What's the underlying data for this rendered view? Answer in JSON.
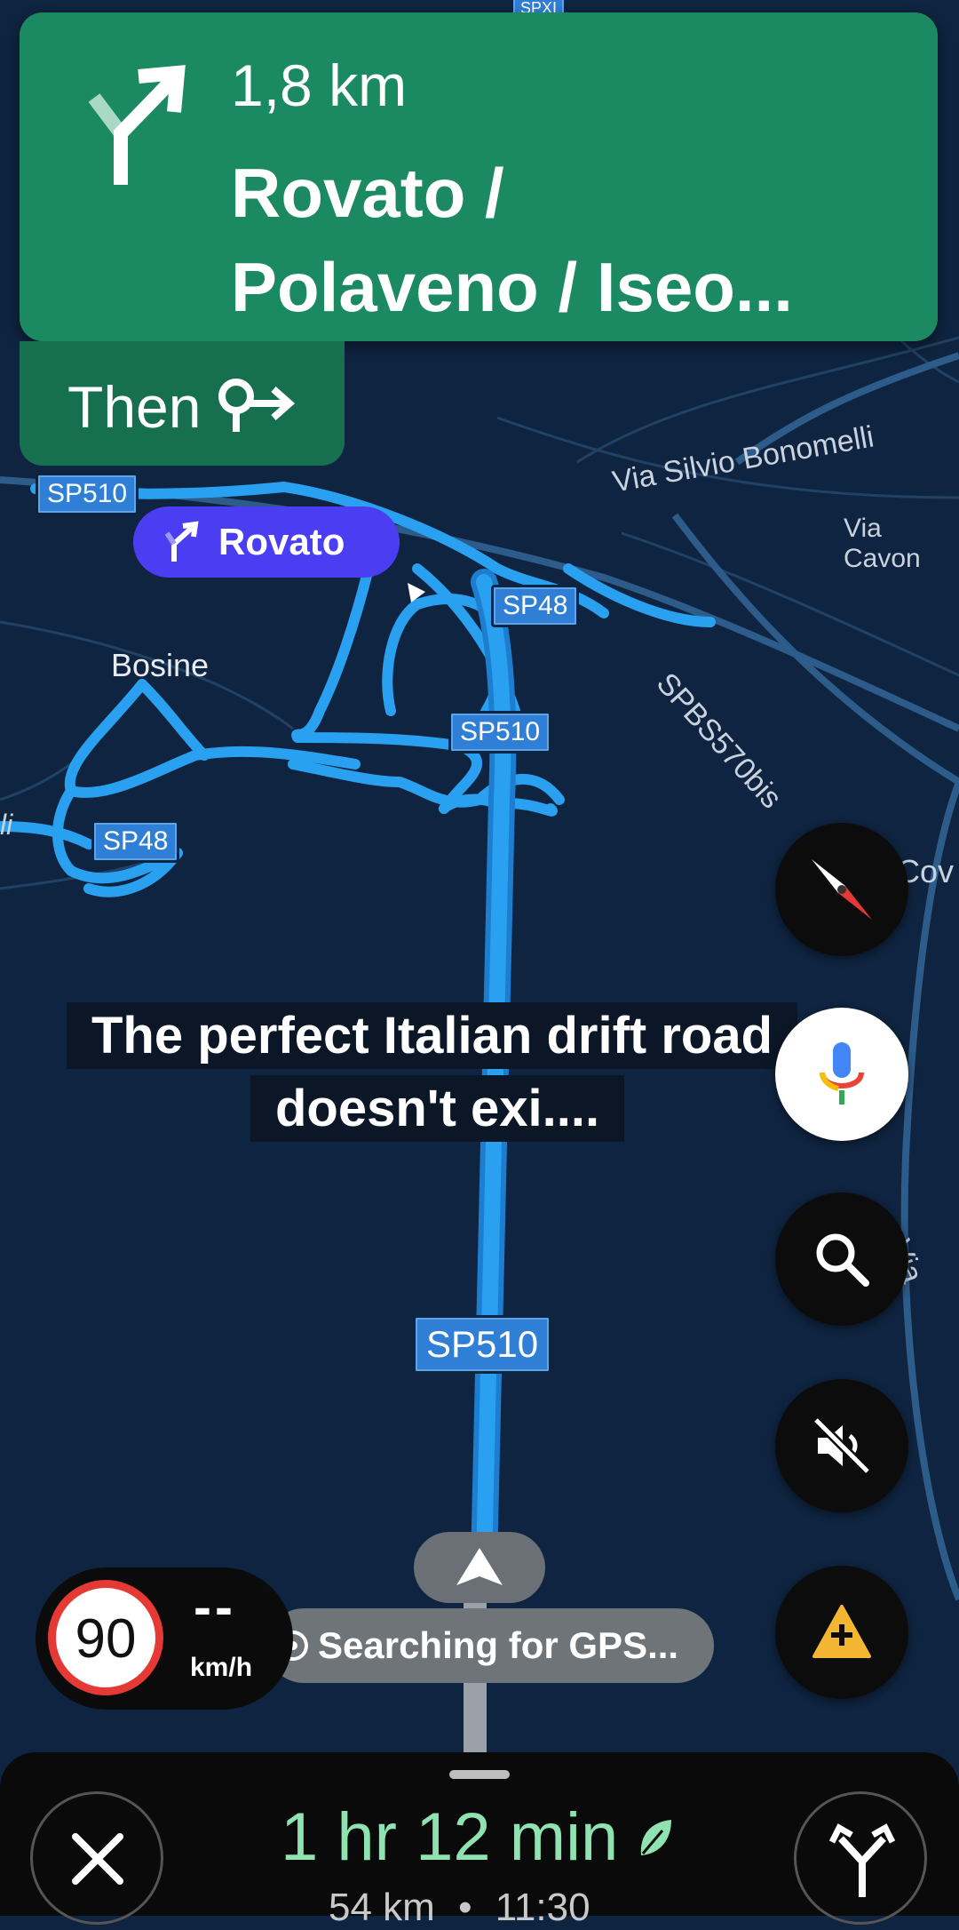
{
  "direction": {
    "distance": "1,8 km",
    "road_line1": "Rovato /",
    "road_line2": "Polaveno / Iseo...",
    "then_label": "Then"
  },
  "map": {
    "top_shield": "SPXI",
    "shields": [
      "SP510",
      "SP48",
      "SP510",
      "SP48",
      "SP510"
    ],
    "labels": {
      "bosine": "Bosine",
      "via_silvio": "Via Silvio Bonomelli",
      "via_cavon": "Via Cavon",
      "spbs": "SPBS570bis",
      "cov": "Cov",
      "via_fen": "Via Fen",
      "li": "li"
    },
    "destination_pill": "Rovato"
  },
  "caption": {
    "line1": "The perfect Italian drift road",
    "line2": "doesn't exi...."
  },
  "speed": {
    "limit": "90",
    "current": "--",
    "unit": "km/h"
  },
  "gps_status": "Searching for GPS...",
  "trip": {
    "eta_hr": "1",
    "eta_hr_label": "hr",
    "eta_min": "12",
    "eta_min_label": "min",
    "distance": "54 km",
    "arrival": "11:30"
  },
  "icons": {
    "turn": "slight-right-turn-icon",
    "then": "keep-right-icon",
    "compass": "compass-icon",
    "voice": "microphone-icon",
    "search": "search-icon",
    "mute": "mute-icon",
    "report": "add-report-icon",
    "close": "close-icon",
    "routes": "alternate-routes-icon",
    "eco": "leaf-icon"
  },
  "colors": {
    "card_green": "#1b8a63",
    "route_blue": "#2aa0f0",
    "map_bg": "#0f2440",
    "pill_purple": "#4a3df2",
    "eta_green": "#8ee3b1"
  }
}
